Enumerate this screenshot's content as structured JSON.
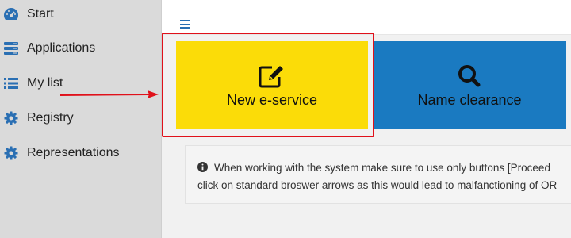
{
  "sidebar": {
    "items": [
      {
        "label": "Start",
        "icon": "dashboard-icon"
      },
      {
        "label": "Applications",
        "icon": "server-icon"
      },
      {
        "label": "My list",
        "icon": "list-icon"
      },
      {
        "label": "Registry",
        "icon": "gear-icon"
      },
      {
        "label": "Representations",
        "icon": "gear-icon"
      }
    ]
  },
  "tiles": {
    "new_eservice": {
      "label": "New e-service",
      "icon": "edit-icon",
      "color": "#fbdc08"
    },
    "name_clearance": {
      "label": "Name clearance",
      "icon": "search-icon",
      "color": "#1a7ac1"
    }
  },
  "info": {
    "line1": "When working with the system make sure to use only buttons [Proceed",
    "line2": "click on standard broswer arrows as this would lead to malfanctioning of OR",
    "icon": "info-icon"
  },
  "colors": {
    "accent_blue": "#2a6fb3",
    "annotation_red": "#e0111b"
  }
}
